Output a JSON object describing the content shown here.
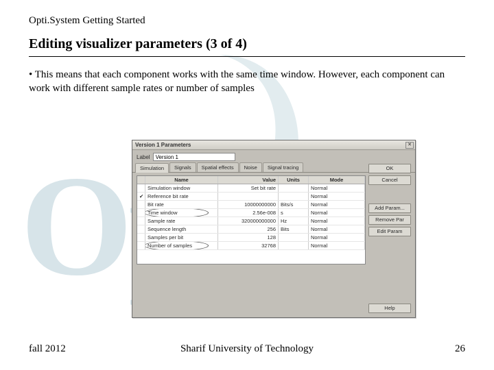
{
  "doc_title": "Opti.System Getting Started",
  "heading": "Editing visualizer parameters (3 of 4)",
  "body_text": "• This means that each component works with the same time window. However, each component can work with different sample rates or number of samples",
  "watermark_text": "Op    ve",
  "dialog": {
    "title": "Version 1 Parameters",
    "close_glyph": "✕",
    "label_text": "Label",
    "label_value": "Version 1",
    "tabs": [
      "Simulation",
      "Signals",
      "Spatial effects",
      "Noise",
      "Signal tracing"
    ],
    "columns": {
      "name": "Name",
      "value": "Value",
      "units": "Units",
      "mode": "Mode"
    },
    "rows": [
      {
        "mark": "",
        "name": "Simulation window",
        "value": "Set bit rate",
        "units": "",
        "mode": "Normal",
        "circled": false
      },
      {
        "mark": "✔",
        "name": "Reference bit rate",
        "value": "",
        "units": "",
        "mode": "Normal",
        "circled": false
      },
      {
        "mark": "",
        "name": "Bit rate",
        "value": "10000000000",
        "units": "Bits/s",
        "mode": "Normal",
        "circled": false
      },
      {
        "mark": "",
        "name": "Time window",
        "value": "2.56e-008",
        "units": "s",
        "mode": "Normal",
        "circled": true
      },
      {
        "mark": "",
        "name": "Sample rate",
        "value": "320000000000",
        "units": "Hz",
        "mode": "Normal",
        "circled": false
      },
      {
        "mark": "",
        "name": "Sequence length",
        "value": "256",
        "units": "Bits",
        "mode": "Normal",
        "circled": false
      },
      {
        "mark": "",
        "name": "Samples per bit",
        "value": "128",
        "units": "",
        "mode": "Normal",
        "circled": false
      },
      {
        "mark": "",
        "name": "Number of samples",
        "value": "32768",
        "units": "",
        "mode": "Normal",
        "circled": true
      }
    ],
    "buttons": {
      "ok": "OK",
      "cancel": "Cancel",
      "add_param": "Add Param...",
      "remove_par": "Remove Par",
      "edit_param": "Edit Param",
      "help": "Help"
    }
  },
  "footer": {
    "left": "fall 2012",
    "center": "Sharif University of Technology",
    "right": "26"
  }
}
